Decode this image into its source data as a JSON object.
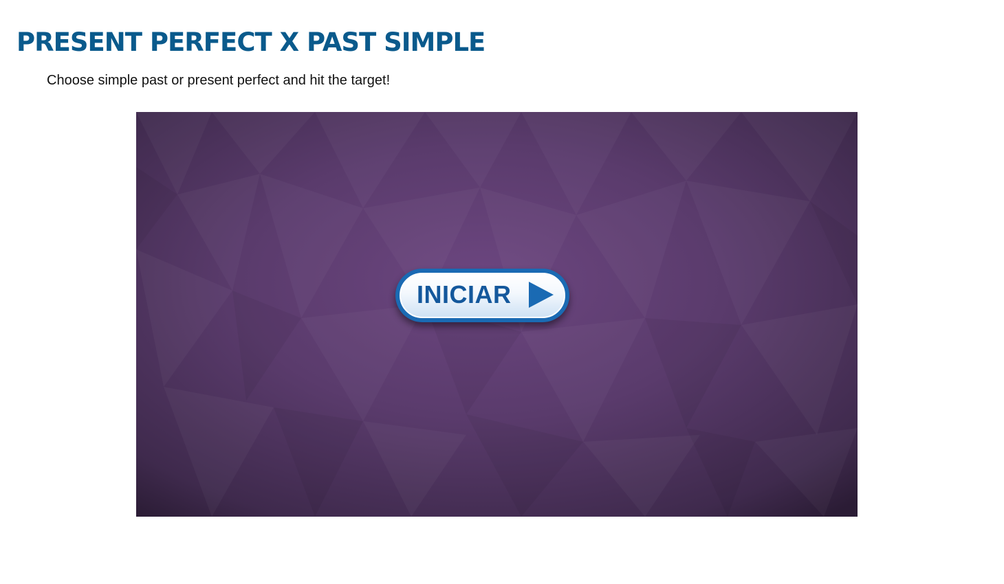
{
  "page": {
    "title": "PRESENT PERFECT X PAST SIMPLE",
    "instructions": "Choose simple past or present perfect and hit the target!"
  },
  "game": {
    "start_button_label": "INICIAR",
    "start_button_icon": "play-arrow-icon",
    "background_color": "#4f3561",
    "accent_color": "#1a6ab3",
    "title_color": "#0a5a8c"
  }
}
